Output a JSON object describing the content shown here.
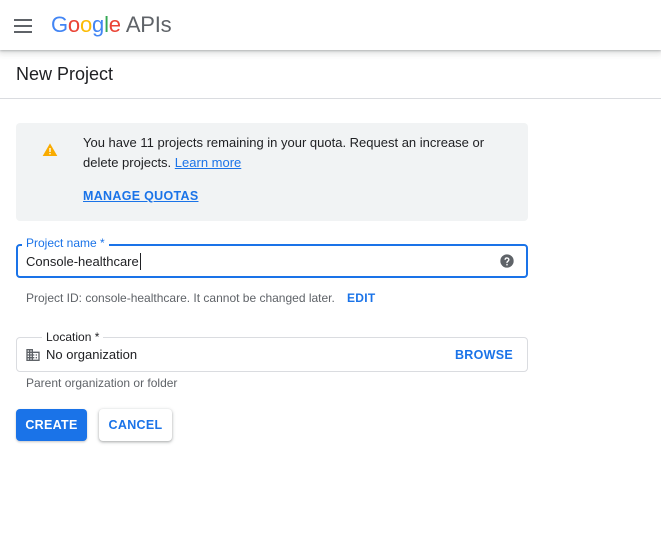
{
  "header": {
    "logo_letters": [
      "G",
      "o",
      "o",
      "g",
      "l",
      "e"
    ],
    "logo_suffix": "APIs"
  },
  "page": {
    "title": "New Project"
  },
  "quota": {
    "message": "You have 11 projects remaining in your quota. Request an increase or delete projects.",
    "learn_more": "Learn more",
    "manage_quotas": "MANAGE QUOTAS"
  },
  "project_name": {
    "label": "Project name *",
    "value": "Console-healthcare"
  },
  "project_id": {
    "text": "Project ID: console-healthcare. It cannot be changed later.",
    "edit": "EDIT"
  },
  "location": {
    "label": "Location *",
    "value": "No organization",
    "browse": "BROWSE",
    "helper": "Parent organization or folder"
  },
  "actions": {
    "create": "CREATE",
    "cancel": "CANCEL"
  },
  "colors": {
    "accent": "#1a73e8",
    "warning": "#f9ab00",
    "info_bg": "#f1f3f4"
  }
}
